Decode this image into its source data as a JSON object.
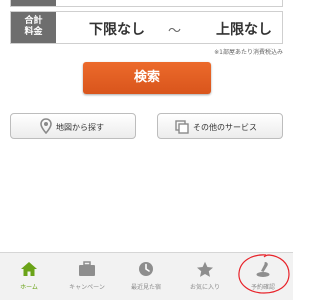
{
  "price": {
    "label_line1": "合計",
    "label_line2": "料金",
    "min": "下限なし",
    "separator": "～",
    "max": "上限なし",
    "tax_note": "※1部屋あたり消費税込み"
  },
  "actions": {
    "search_label": "検索",
    "map_search_label": "地図から探す",
    "other_services_label": "その他のサービス"
  },
  "tabs": [
    {
      "label": "ホーム",
      "icon": "home-icon",
      "active": true
    },
    {
      "label": "キャンペーン",
      "icon": "briefcase-icon",
      "active": false
    },
    {
      "label": "最近見た宿",
      "icon": "clock-icon",
      "active": false
    },
    {
      "label": "お気に入り",
      "icon": "star-icon",
      "active": false
    },
    {
      "label": "予約確認",
      "icon": "booking-icon",
      "active": false
    }
  ],
  "colors": {
    "accent": "#e2602a",
    "active_tab": "#6aa318",
    "highlight_circle": "#e8232a"
  }
}
